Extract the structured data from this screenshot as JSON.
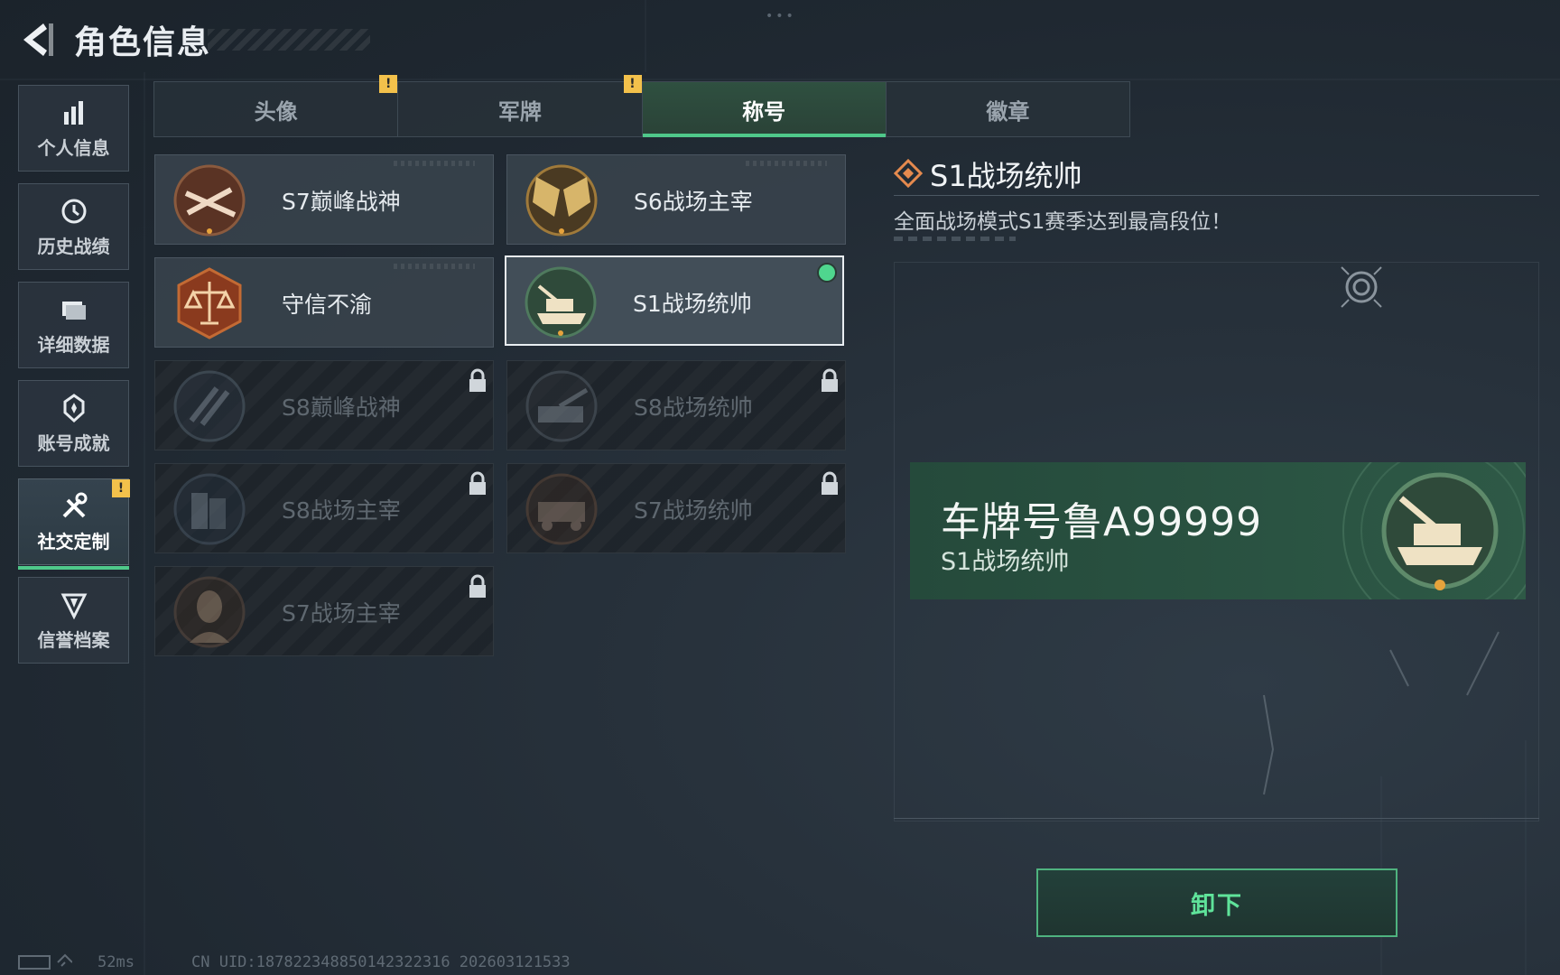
{
  "header": {
    "title": "角色信息"
  },
  "sidebar": {
    "items": [
      {
        "label": "个人信息",
        "icon": "bar-chart-icon"
      },
      {
        "label": "历史战绩",
        "icon": "history-clock-icon"
      },
      {
        "label": "详细数据",
        "icon": "folder-icon"
      },
      {
        "label": "账号成就",
        "icon": "achievement-badge-icon"
      },
      {
        "label": "社交定制",
        "icon": "tools-icon",
        "active": true,
        "badge": "!"
      },
      {
        "label": "信誉档案",
        "icon": "shield-emblem-icon"
      }
    ]
  },
  "tabs": [
    {
      "label": "头像",
      "badge": "!"
    },
    {
      "label": "军牌",
      "badge": "!"
    },
    {
      "label": "称号",
      "active": true
    },
    {
      "label": "徽章"
    }
  ],
  "cards": [
    {
      "name": "S7巅峰战神",
      "locked": false,
      "emblem": "crossed-rifles-emblem"
    },
    {
      "name": "S6战场主宰",
      "locked": false,
      "emblem": "crossed-flags-emblem"
    },
    {
      "name": "守信不渝",
      "locked": false,
      "emblem": "scales-emblem"
    },
    {
      "name": "S1战场统帅",
      "locked": false,
      "selected": true,
      "equipped": true,
      "emblem": "tank-emblem"
    },
    {
      "name": "S8巅峰战神",
      "locked": true,
      "emblem": "slash-emblem"
    },
    {
      "name": "S8战场统帅",
      "locked": true,
      "emblem": "artillery-emblem"
    },
    {
      "name": "S8战场主宰",
      "locked": true,
      "emblem": "building-emblem"
    },
    {
      "name": "S7战场统帅",
      "locked": true,
      "emblem": "armored-car-emblem"
    },
    {
      "name": "S7战场主宰",
      "locked": true,
      "emblem": "soldier-portrait-emblem"
    }
  ],
  "detail": {
    "title": "S1战场统帅",
    "description": "全面战场模式S1赛季达到最高段位！",
    "plate_main": "车牌号鲁A99999",
    "plate_sub": "S1战场统帅"
  },
  "actions": {
    "unequip_label": "卸下"
  },
  "footer": {
    "ping": "52ms",
    "uid": "CN UID:187822348850142322316 202603121533"
  },
  "colors": {
    "accent_green": "#4fc88a",
    "warning_yellow": "#f3c14b",
    "plate_green": "#2a5342"
  }
}
